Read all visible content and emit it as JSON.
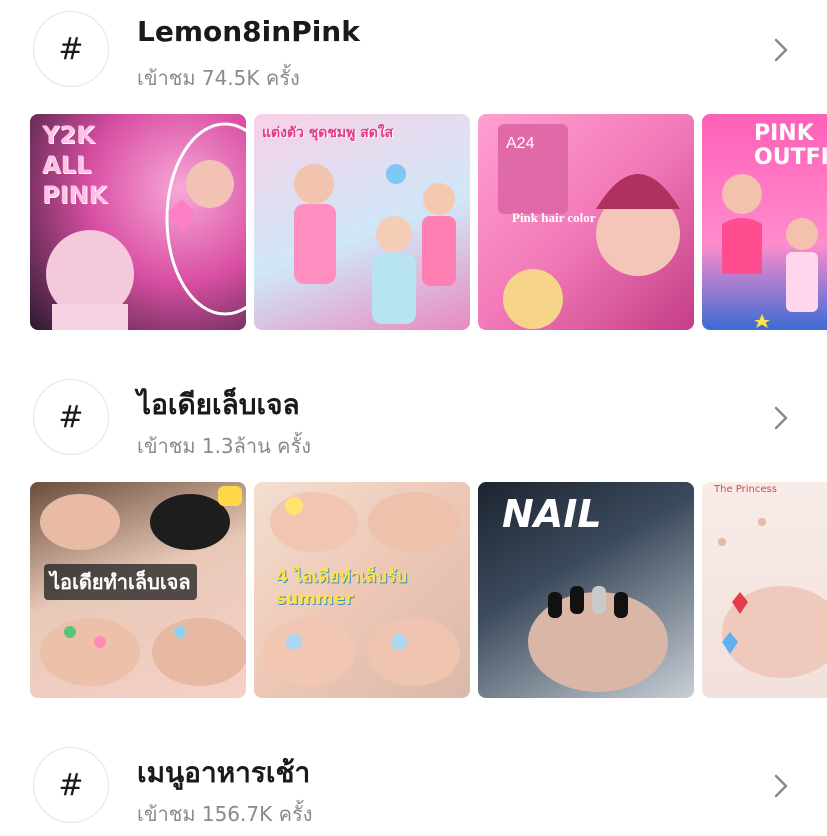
{
  "hashtags": [
    {
      "symbol": "#",
      "title": "Lemon8inPink",
      "views": "เข้าชม 74.5K ครั้ง",
      "thumbnails": [
        {
          "caption": "Y2K ALL PINK",
          "colors": [
            "#f7a8d8",
            "#d94fa3",
            "#2a1a2e"
          ]
        },
        {
          "caption": "แต่งตัว ชุดชมพู สดใส",
          "colors": [
            "#f9d1e6",
            "#b6d9f5",
            "#e889c1"
          ]
        },
        {
          "caption": "Pink hair color",
          "colors": [
            "#f27ab8",
            "#ff9fd0",
            "#c43d86"
          ]
        },
        {
          "caption": "PINK OUTFIT",
          "colors": [
            "#ff5fb8",
            "#ffd6ec",
            "#3c6bd4"
          ]
        }
      ]
    },
    {
      "symbol": "#",
      "title": "ไอเดียเล็บเจล",
      "views": "เข้าชม 1.3ล้าน ครั้ง",
      "thumbnails": [
        {
          "caption": "ไอเดียทำเล็บเจล",
          "colors": [
            "#e8c9b8",
            "#f5d0c8",
            "#6a4c3c"
          ]
        },
        {
          "caption": "4 ไอเดียทำเล็บรับ summer",
          "colors": [
            "#eec7b6",
            "#a9d8f0",
            "#f2dfd0"
          ]
        },
        {
          "caption": "NAIL",
          "colors": [
            "#3b4a5c",
            "#c9cfd6",
            "#1d2430"
          ]
        },
        {
          "caption": "The Princess",
          "colors": [
            "#f8ece8",
            "#f2c9c0",
            "#e7d9d4"
          ]
        }
      ]
    },
    {
      "symbol": "#",
      "title": "เมนูอาหารเช้า",
      "views": "เข้าชม 156.7K ครั้ง",
      "thumbnails": []
    }
  ],
  "icons": {
    "chevron": "chevron-right-icon"
  }
}
